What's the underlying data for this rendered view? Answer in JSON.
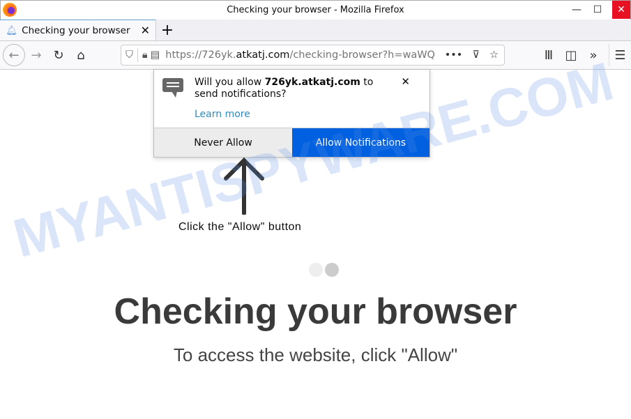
{
  "window": {
    "title": "Checking your browser - Mozilla Firefox"
  },
  "tab": {
    "title": "Checking your browser"
  },
  "url": {
    "scheme": "https://726yk.",
    "host": "atkatj.com",
    "path": "/checking-browser?h=waWQ"
  },
  "popup": {
    "msg_pre": "Will you allow ",
    "msg_host": "726yk.atkatj.com",
    "msg_post": " to send notifications?",
    "learn_more": "Learn more",
    "never_allow": "Never Allow",
    "allow": "Allow Notifications"
  },
  "page": {
    "hint": "Click the \"Allow\" button",
    "title": "Checking your browser",
    "subtitle": "To access the website, click \"Allow\""
  },
  "watermark": "MYANTISPYWARE.COM",
  "colors": {
    "allow_button": "#0060df",
    "close_button": "#e81123"
  }
}
